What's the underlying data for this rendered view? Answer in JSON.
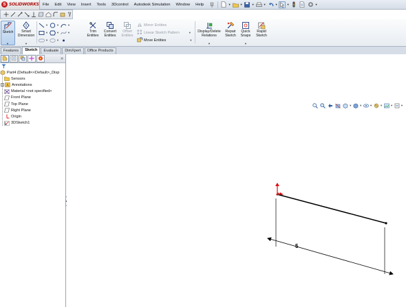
{
  "app": {
    "logo_text": "SOLIDWORKS",
    "accent": "#c81e1e"
  },
  "menubar": {
    "items": [
      "File",
      "Edit",
      "View",
      "Insert",
      "Tools",
      "3Dcontrol",
      "Autodesk Simulation",
      "Window",
      "Help"
    ],
    "pin_icon": "pin-icon",
    "toolbar_icons": [
      "new-document-icon",
      "open-icon",
      "save-icon",
      "print-icon",
      "undo-icon",
      "select-icon",
      "rebuild-icon",
      "file-properties-icon",
      "options-icon"
    ]
  },
  "quickbar": {
    "icons": [
      "point-icon",
      "line-icon",
      "arc-icon",
      "spline-icon",
      "smart-dimension-icon",
      "plane-icon",
      "home-icon",
      "fillet-icon",
      "trim-icon",
      "help-icon"
    ]
  },
  "command_manager": {
    "sketch": "Sketch",
    "smart_dimension_1": "Smart",
    "smart_dimension_2": "Dimension",
    "trim_1": "Trim",
    "trim_2": "Entities",
    "convert_1": "Convert",
    "convert_2": "Entities",
    "offset_1": "Offset",
    "offset_2": "Entities",
    "mirror": "Mirror Entities",
    "linear_pattern": "Linear Sketch Pattern",
    "move": "Move Entities",
    "display_relations_1": "Display/Delete",
    "display_relations_2": "Relations",
    "repair_1": "Repair",
    "repair_2": "Sketch",
    "quick_snaps_1": "Quick",
    "quick_snaps_2": "Snaps",
    "rapid_1": "Rapid",
    "rapid_2": "Sketch"
  },
  "tabs": [
    "Features",
    "Sketch",
    "Evaluate",
    "DimXpert",
    "Office Products"
  ],
  "active_tab": "Sketch",
  "panel": {
    "more_glyph": "»",
    "tree": {
      "root": "Part4  (Default<<Default>_Disp",
      "items": [
        {
          "label": "Sensors",
          "icon": "sensors-icon"
        },
        {
          "label": "Annotations",
          "icon": "annotations-icon"
        },
        {
          "label": "Material <not specified>",
          "icon": "material-icon"
        },
        {
          "label": "Front Plane",
          "icon": "plane-icon"
        },
        {
          "label": "Top Plane",
          "icon": "plane-icon"
        },
        {
          "label": "Right Plane",
          "icon": "plane-icon"
        },
        {
          "label": "Origin",
          "icon": "origin-icon"
        },
        {
          "label": "3DSketch1",
          "icon": "sketch-icon"
        }
      ]
    }
  },
  "viewport": {
    "dimension_value": "5",
    "heads_up_icons": [
      "zoom-to-fit-icon",
      "zoom-area-icon",
      "previous-view-icon",
      "section-view-icon",
      "view-orientation-icon",
      "display-style-icon",
      "hide-show-icon",
      "edit-appearance-icon",
      "apply-scene-icon",
      "view-settings-icon"
    ],
    "sketch_line_color": "#000000",
    "origin_color": "#e01010"
  }
}
